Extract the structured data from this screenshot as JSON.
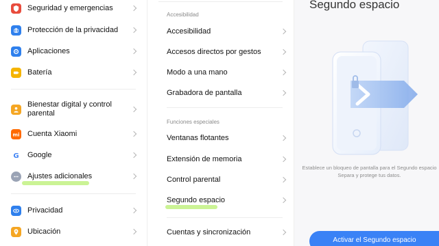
{
  "left": {
    "items": [
      {
        "label": "Seguridad y emergencias",
        "icon": "shield-emergency-icon",
        "color": "#e84c3d"
      },
      {
        "label": "Protección de la privacidad",
        "icon": "privacy-protection-icon",
        "color": "#2f80ed"
      },
      {
        "label": "Aplicaciones",
        "icon": "apps-gear-icon",
        "color": "#2f80ed"
      },
      {
        "label": "Batería",
        "icon": "battery-icon",
        "color": "#f5b400"
      },
      {
        "label": "Bienestar digital y control parental",
        "icon": "wellbeing-icon",
        "color": "#f5a623"
      },
      {
        "label": "Cuenta Xiaomi",
        "icon": "xiaomi-account-icon",
        "color": "#ff6a00"
      },
      {
        "label": "Google",
        "icon": "google-icon",
        "color": "#ffffff"
      },
      {
        "label": "Ajustes adicionales",
        "icon": "more-dots-icon",
        "color": "#9aa3b5"
      },
      {
        "label": "Privacidad",
        "icon": "privacy-eye-icon",
        "color": "#2f80ed"
      },
      {
        "label": "Ubicación",
        "icon": "location-icon",
        "color": "#f5a623"
      }
    ]
  },
  "middle": {
    "section1": "Accesibilidad",
    "section2": "Funciones especiales",
    "items": [
      {
        "label": "Accesibilidad"
      },
      {
        "label": "Accesos directos por gestos"
      },
      {
        "label": "Modo a una mano"
      },
      {
        "label": "Grabadora de pantalla"
      },
      {
        "label": "Ventanas flotantes"
      },
      {
        "label": "Extensión de memoria"
      },
      {
        "label": "Control parental"
      },
      {
        "label": "Segundo espacio"
      },
      {
        "label": "Cuentas y sincronización"
      }
    ]
  },
  "right": {
    "title": "Segundo espacio",
    "description_line1": "Establece un bloqueo de pantalla para el Segundo espacio",
    "description_line2": "Separa y protege tus datos.",
    "button": "Activar el Segundo espacio"
  },
  "colors": {
    "accent": "#3a82f6",
    "highlight": "#c5f28a"
  }
}
